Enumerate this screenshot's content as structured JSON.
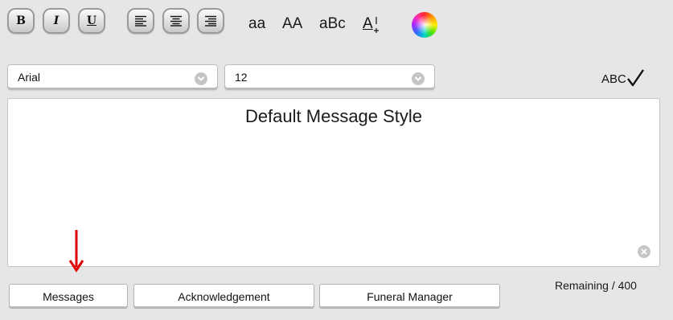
{
  "toolbar": {
    "bold_glyph": "B",
    "italic_glyph": "I",
    "underline_glyph": "U",
    "case_lower": "aa",
    "case_upper": "AA",
    "case_mixed": "aBc",
    "font_size_grow": "A",
    "icons": [
      "align-left-icon",
      "align-center-icon",
      "align-right-icon",
      "font-size-plus-icon",
      "color-wheel-icon"
    ]
  },
  "font_select": {
    "value": "Arial"
  },
  "size_select": {
    "value": "12"
  },
  "spellcheck": {
    "label": "ABC"
  },
  "message": {
    "text": "Default Message Style"
  },
  "tabs": [
    {
      "label": "Messages"
    },
    {
      "label": "Acknowledgement"
    },
    {
      "label": "Funeral Manager"
    }
  ],
  "remaining": {
    "text": "Remaining / 400"
  },
  "colors": {
    "background": "#e6e6e8",
    "annotation_arrow": "#e00000"
  }
}
